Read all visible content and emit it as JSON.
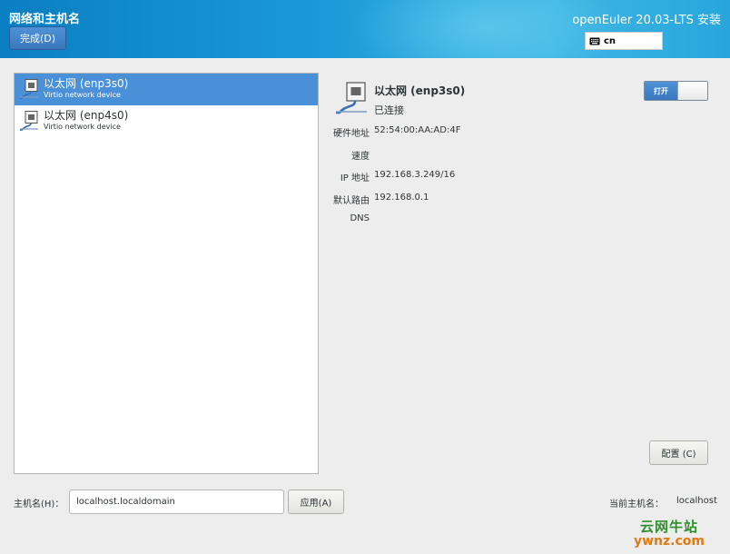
{
  "header": {
    "page_title": "网络和主机名",
    "done_button": "完成(D)",
    "product_title": "openEuler 20.03-LTS 安装",
    "keyboard_layout": "cn"
  },
  "devices": [
    {
      "name": "以太网 (enp3s0)",
      "description": "Virtio network device",
      "selected": true
    },
    {
      "name": "以太网 (enp4s0)",
      "description": "Virtio network device",
      "selected": false
    }
  ],
  "detail": {
    "title": "以太网 (enp3s0)",
    "status": "已连接",
    "switch_label": "打开",
    "properties": [
      {
        "label": "硬件地址",
        "value": "52:54:00:AA:AD:4F"
      },
      {
        "label": "速度",
        "value": ""
      },
      {
        "label": "IP 地址",
        "value": "192.168.3.249/16"
      },
      {
        "label": "默认路由",
        "value": "192.168.0.1"
      },
      {
        "label": "DNS",
        "value": ""
      }
    ],
    "config_button": "配置 (C)"
  },
  "hostname": {
    "label": "主机名(H)：",
    "value": "localhost.localdomain",
    "apply_button": "应用(A)",
    "current_label": "当前主机名：",
    "current_value": "localhost"
  },
  "watermark": {
    "line1": "云网牛站",
    "line2": "ywnz.com"
  },
  "colors": {
    "header_blue": "#1a9ad8",
    "selection_blue": "#4a90d9",
    "background": "#ededed"
  }
}
